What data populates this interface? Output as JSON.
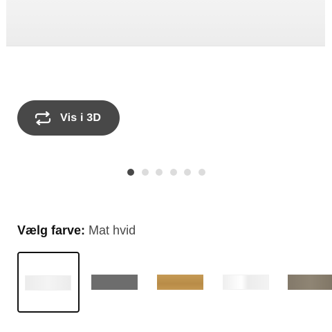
{
  "view_3d": {
    "label": "Vis i 3D",
    "icon": "rotate-3d-icon"
  },
  "carousel": {
    "total_dots": 6,
    "active_index": 0
  },
  "color_selector": {
    "heading_key": "Vælg farve:",
    "heading_value": "Mat hvid",
    "swatches": [
      {
        "name": "Mat hvid",
        "color": "#efefef",
        "selected": true
      },
      {
        "name": "grey",
        "color": "#6d6d6d",
        "selected": false
      },
      {
        "name": "oak",
        "color": "#c09450",
        "selected": false
      },
      {
        "name": "white-gloss",
        "color": "#f6f6f6",
        "selected": false
      },
      {
        "name": "taupe",
        "color": "#877c6c",
        "selected": false
      }
    ]
  },
  "colors": {
    "button_bg": "#484848",
    "dot_active": "#484848",
    "dot_inactive": "#dcdcdc",
    "selected_border": "#111111"
  }
}
